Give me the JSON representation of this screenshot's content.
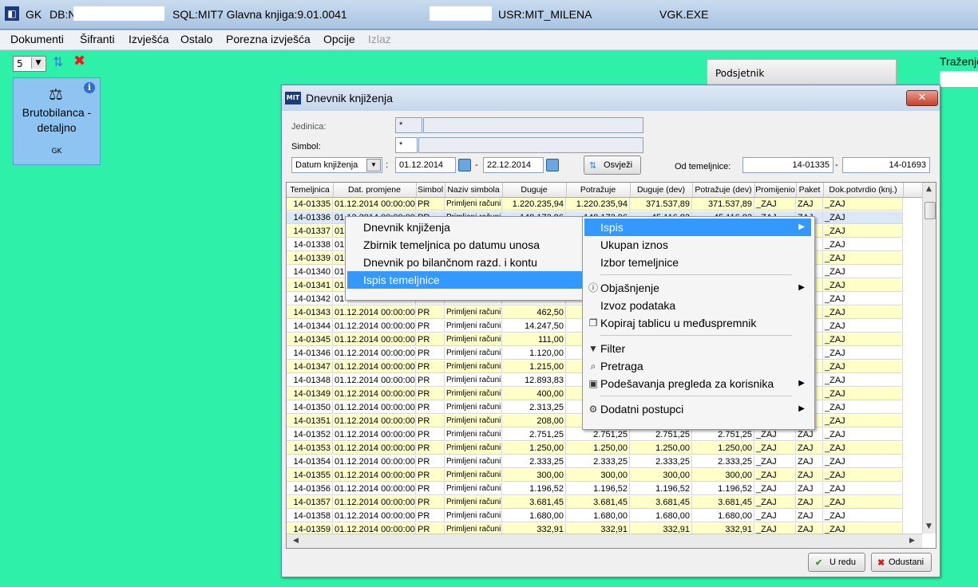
{
  "titlebar": {
    "app": "GK",
    "db": "DB:N",
    "sql": "SQL:MIT7  Glavna knjiga:9.01.0041",
    "usr": "USR:MIT_MILENA",
    "exe": "VGK.EXE"
  },
  "menubar": [
    "Dokumenti",
    "Šifranti",
    "Izvješća",
    "Ostalo",
    "Porezna izvješća",
    "Opcije",
    "Izlaz"
  ],
  "toolbar": {
    "select_value": "5"
  },
  "tile": {
    "title1": "Brutobilanca -",
    "title2": "detaljno",
    "subtitle": "GK"
  },
  "podsjetnik": "Podsjetnik",
  "trazenje": "Traženje",
  "dialog": {
    "title": "Dnevnik knjiženja",
    "logo": "MIT",
    "close": "✕",
    "jedinica_label": "Jedinica:",
    "jedinica_value": "*",
    "simbol_label": "Simbol:",
    "simbol_value": "*",
    "date_mode": "Datum knjiženja",
    "date_from": "01.12.2014",
    "date_to": "22.12.2014",
    "sep1": ":",
    "sep2": "-",
    "sep3": "-",
    "refresh_label": "Osvježi",
    "od_label": "Od temeljnice:",
    "od_from": "14-01335",
    "od_to": "14-01693",
    "ok_label": "U redu",
    "cancel_label": "Odustani"
  },
  "grid": {
    "columns": [
      "Temeljnica",
      "Dat. promjene",
      "Simbol",
      "Naziv simbola",
      "Duguje",
      "Potražuje",
      "Duguje (dev)",
      "Potražuje (dev)",
      "Promijenio",
      "Paket",
      "Dok.potvrdio (knj.)"
    ],
    "rows": [
      [
        "14-01335",
        "01.12.2014 00:00:00",
        "PR",
        "Primljeni računi",
        "1.220.235,94",
        "1.220.235,94",
        "371.537,89",
        "371.537,89",
        "_ZAJ",
        "ZAJ",
        "_ZAJ"
      ],
      [
        "14-01336",
        "01.12.2014 00:00:00",
        "PR",
        "Primljeni računi",
        "148.173,96",
        "148.173,96",
        "45.116,83",
        "45.116,83",
        "_ZAJ",
        "ZAJ",
        "_ZAJ"
      ],
      [
        "14-01337",
        "01",
        "",
        "",
        "",
        "",
        "",
        "",
        "",
        "",
        "_ZAJ"
      ],
      [
        "14-01338",
        "01",
        "",
        "",
        "",
        "",
        "",
        "",
        "",
        "",
        "_ZAJ"
      ],
      [
        "14-01339",
        "01",
        "",
        "",
        "",
        "",
        "",
        "",
        "",
        "",
        "_ZAJ"
      ],
      [
        "14-01340",
        "01",
        "",
        "",
        "",
        "",
        "",
        "",
        "",
        "",
        "_ZAJ"
      ],
      [
        "14-01341",
        "01",
        "",
        "",
        "",
        "",
        "",
        "",
        "",
        "",
        "_ZAJ"
      ],
      [
        "14-01342",
        "01",
        "",
        "",
        "",
        "",
        "",
        "",
        "",
        "",
        "_ZAJ"
      ],
      [
        "14-01343",
        "01.12.2014 00:00:00",
        "PR",
        "Primljeni računi",
        "462,50",
        "",
        "",
        "",
        "",
        "",
        "_ZAJ"
      ],
      [
        "14-01344",
        "01.12.2014 00:00:00",
        "PR",
        "Primljeni računi",
        "14.247,50",
        "",
        "",
        "",
        "",
        "",
        "_ZAJ"
      ],
      [
        "14-01345",
        "01.12.2014 00:00:00",
        "PR",
        "Primljeni računi",
        "111,00",
        "",
        "",
        "",
        "",
        "",
        "_ZAJ"
      ],
      [
        "14-01346",
        "01.12.2014 00:00:00",
        "PR",
        "Primljeni računi",
        "1.120,00",
        "",
        "",
        "",
        "",
        "",
        "_ZAJ"
      ],
      [
        "14-01347",
        "01.12.2014 00:00:00",
        "PR",
        "Primljeni računi",
        "1.215,00",
        "",
        "",
        "",
        "",
        "",
        "_ZAJ"
      ],
      [
        "14-01348",
        "01.12.2014 00:00:00",
        "PR",
        "Primljeni računi",
        "12.893,83",
        "",
        "",
        "",
        "",
        "",
        "_ZAJ"
      ],
      [
        "14-01349",
        "01.12.2014 00:00:00",
        "PR",
        "Primljeni računi",
        "400,00",
        "",
        "",
        "",
        "",
        "",
        "_ZAJ"
      ],
      [
        "14-01350",
        "01.12.2014 00:00:00",
        "PR",
        "Primljeni računi",
        "2.313,25",
        "",
        "",
        "",
        "",
        "",
        "_ZAJ"
      ],
      [
        "14-01351",
        "01.12.2014 00:00:00",
        "PR",
        "Primljeni računi",
        "208,00",
        "",
        "",
        "",
        "",
        "",
        "_ZAJ"
      ],
      [
        "14-01352",
        "01.12.2014 00:00:00",
        "PR",
        "Primljeni računi",
        "2.751,25",
        "2.751,25",
        "2.751,25",
        "2.751,25",
        "_ZAJ",
        "ZAJ",
        "_ZAJ"
      ],
      [
        "14-01353",
        "01.12.2014 00:00:00",
        "PR",
        "Primljeni računi",
        "1.250,00",
        "1.250,00",
        "1.250,00",
        "1.250,00",
        "_ZAJ",
        "ZAJ",
        "_ZAJ"
      ],
      [
        "14-01354",
        "01.12.2014 00:00:00",
        "PR",
        "Primljeni računi",
        "2.333,25",
        "2.333,25",
        "2.333,25",
        "2.333,25",
        "_ZAJ",
        "ZAJ",
        "_ZAJ"
      ],
      [
        "14-01355",
        "01.12.2014 00:00:00",
        "PR",
        "Primljeni računi",
        "300,00",
        "300,00",
        "300,00",
        "300,00",
        "_ZAJ",
        "ZAJ",
        "_ZAJ"
      ],
      [
        "14-01356",
        "01.12.2014 00:00:00",
        "PR",
        "Primljeni računi",
        "1.196,52",
        "1.196,52",
        "1.196,52",
        "1.196,52",
        "_ZAJ",
        "ZAJ",
        "_ZAJ"
      ],
      [
        "14-01357",
        "01.12.2014 00:00:00",
        "PR",
        "Primljeni računi",
        "3.681,45",
        "3.681,45",
        "3.681,45",
        "3.681,45",
        "_ZAJ",
        "ZAJ",
        "_ZAJ"
      ],
      [
        "14-01358",
        "01.12.2014 00:00:00",
        "PR",
        "Primljeni računi",
        "1.680,00",
        "1.680,00",
        "1.680,00",
        "1.680,00",
        "_ZAJ",
        "ZAJ",
        "_ZAJ"
      ],
      [
        "14-01359",
        "01.12.2014 00:00:00",
        "PR",
        "Primljeni računi",
        "332,91",
        "332,91",
        "332,91",
        "332,91",
        "_ZAJ",
        "ZAJ",
        "_ZAJ"
      ]
    ]
  },
  "context_menu": {
    "items": [
      {
        "label": "Ispis",
        "icon": "",
        "submenu": true,
        "highlighted": true
      },
      {
        "label": "Ukupan iznos",
        "icon": "",
        "submenu": false
      },
      {
        "label": "Izbor temeljnice",
        "icon": "",
        "submenu": false
      },
      {
        "sep": true
      },
      {
        "label": "Objašnjenje",
        "icon": "info-icon",
        "submenu": true
      },
      {
        "label": "Izvoz podataka",
        "icon": "",
        "submenu": false
      },
      {
        "label": "Kopiraj tablicu u međuspremnik",
        "icon": "copy-icon",
        "submenu": false
      },
      {
        "sep": true
      },
      {
        "label": "Filter",
        "icon": "filter-icon",
        "submenu": false
      },
      {
        "label": "Pretraga",
        "icon": "search-icon",
        "submenu": false
      },
      {
        "label": "Podešavanja pregleda za korisnika",
        "icon": "settings-icon",
        "submenu": true
      },
      {
        "sep": true
      },
      {
        "label": "Dodatni postupci",
        "icon": "gear-icon",
        "submenu": true
      }
    ]
  },
  "print_submenu": {
    "items": [
      {
        "label": "Dnevnik knjiženja",
        "highlighted": false
      },
      {
        "label": "Zbirnik temeljnica po datumu unosa",
        "highlighted": false
      },
      {
        "label": "Dnevnik po bilančnom razd. i kontu",
        "highlighted": false
      },
      {
        "label": "Ispis temeljnice",
        "highlighted": true
      }
    ]
  },
  "colors": {
    "desktop": "#2ef0a8",
    "highlight": "#3399ff",
    "yellow_cell": "#ffffc8"
  }
}
